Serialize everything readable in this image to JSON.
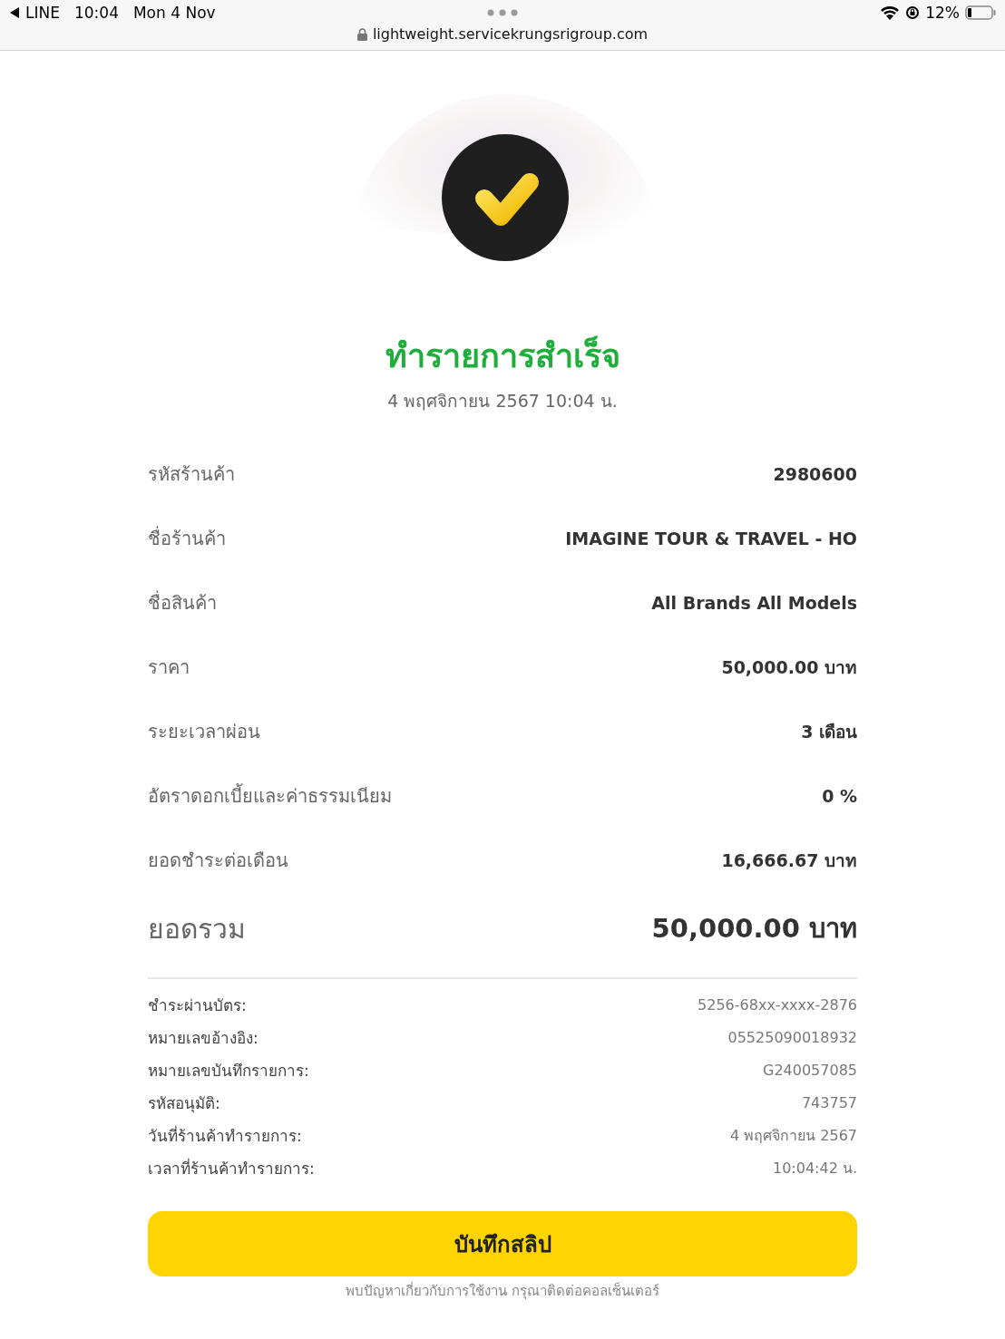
{
  "status_bar": {
    "back_app": "LINE",
    "time": "10:04",
    "date": "Mon 4 Nov",
    "battery": "12%",
    "url": "lightweight.servicekrungsrigroup.com"
  },
  "result": {
    "title": "ทำรายการสำเร็จ",
    "datetime": "4 พฤศจิกายน 2567 10:04 น."
  },
  "summary": [
    {
      "label": "รหัสร้านค้า",
      "value": "2980600"
    },
    {
      "label": "ชื่อร้านค้า",
      "value": "IMAGINE TOUR & TRAVEL - HO"
    },
    {
      "label": "ชื่อสินค้า",
      "value": "All Brands All Models"
    },
    {
      "label": "ราคา",
      "value": "50,000.00 บาท"
    },
    {
      "label": "ระยะเวลาผ่อน",
      "value": "3 เดือน"
    },
    {
      "label": "อัตราดอกเบี้ยและค่าธรรมเนียม",
      "value": "0 %"
    },
    {
      "label": "ยอดชำระต่อเดือน",
      "value": "16,666.67 บาท"
    }
  ],
  "total": {
    "label": "ยอดรวม",
    "value": "50,000.00 บาท"
  },
  "details": [
    {
      "label": "ชำระผ่านบัตร:",
      "value": "5256-68xx-xxxx-2876"
    },
    {
      "label": "หมายเลขอ้างอิง:",
      "value": "05525090018932"
    },
    {
      "label": "หมายเลขบันทึกรายการ:",
      "value": "G240057085"
    },
    {
      "label": "รหัสอนุมัติ:",
      "value": "743757"
    },
    {
      "label": "วันที่ร้านค้าทำรายการ:",
      "value": "4 พฤศจิกายน 2567"
    },
    {
      "label": "เวลาที่ร้านค้าทำรายการ:",
      "value": "10:04:42 น."
    }
  ],
  "save_button": "บันทึกสลิป",
  "footer_note": "พบปัญหาเกี่ยวกับการใช้งาน กรุณาติดต่อคอลเซ็นเตอร์"
}
